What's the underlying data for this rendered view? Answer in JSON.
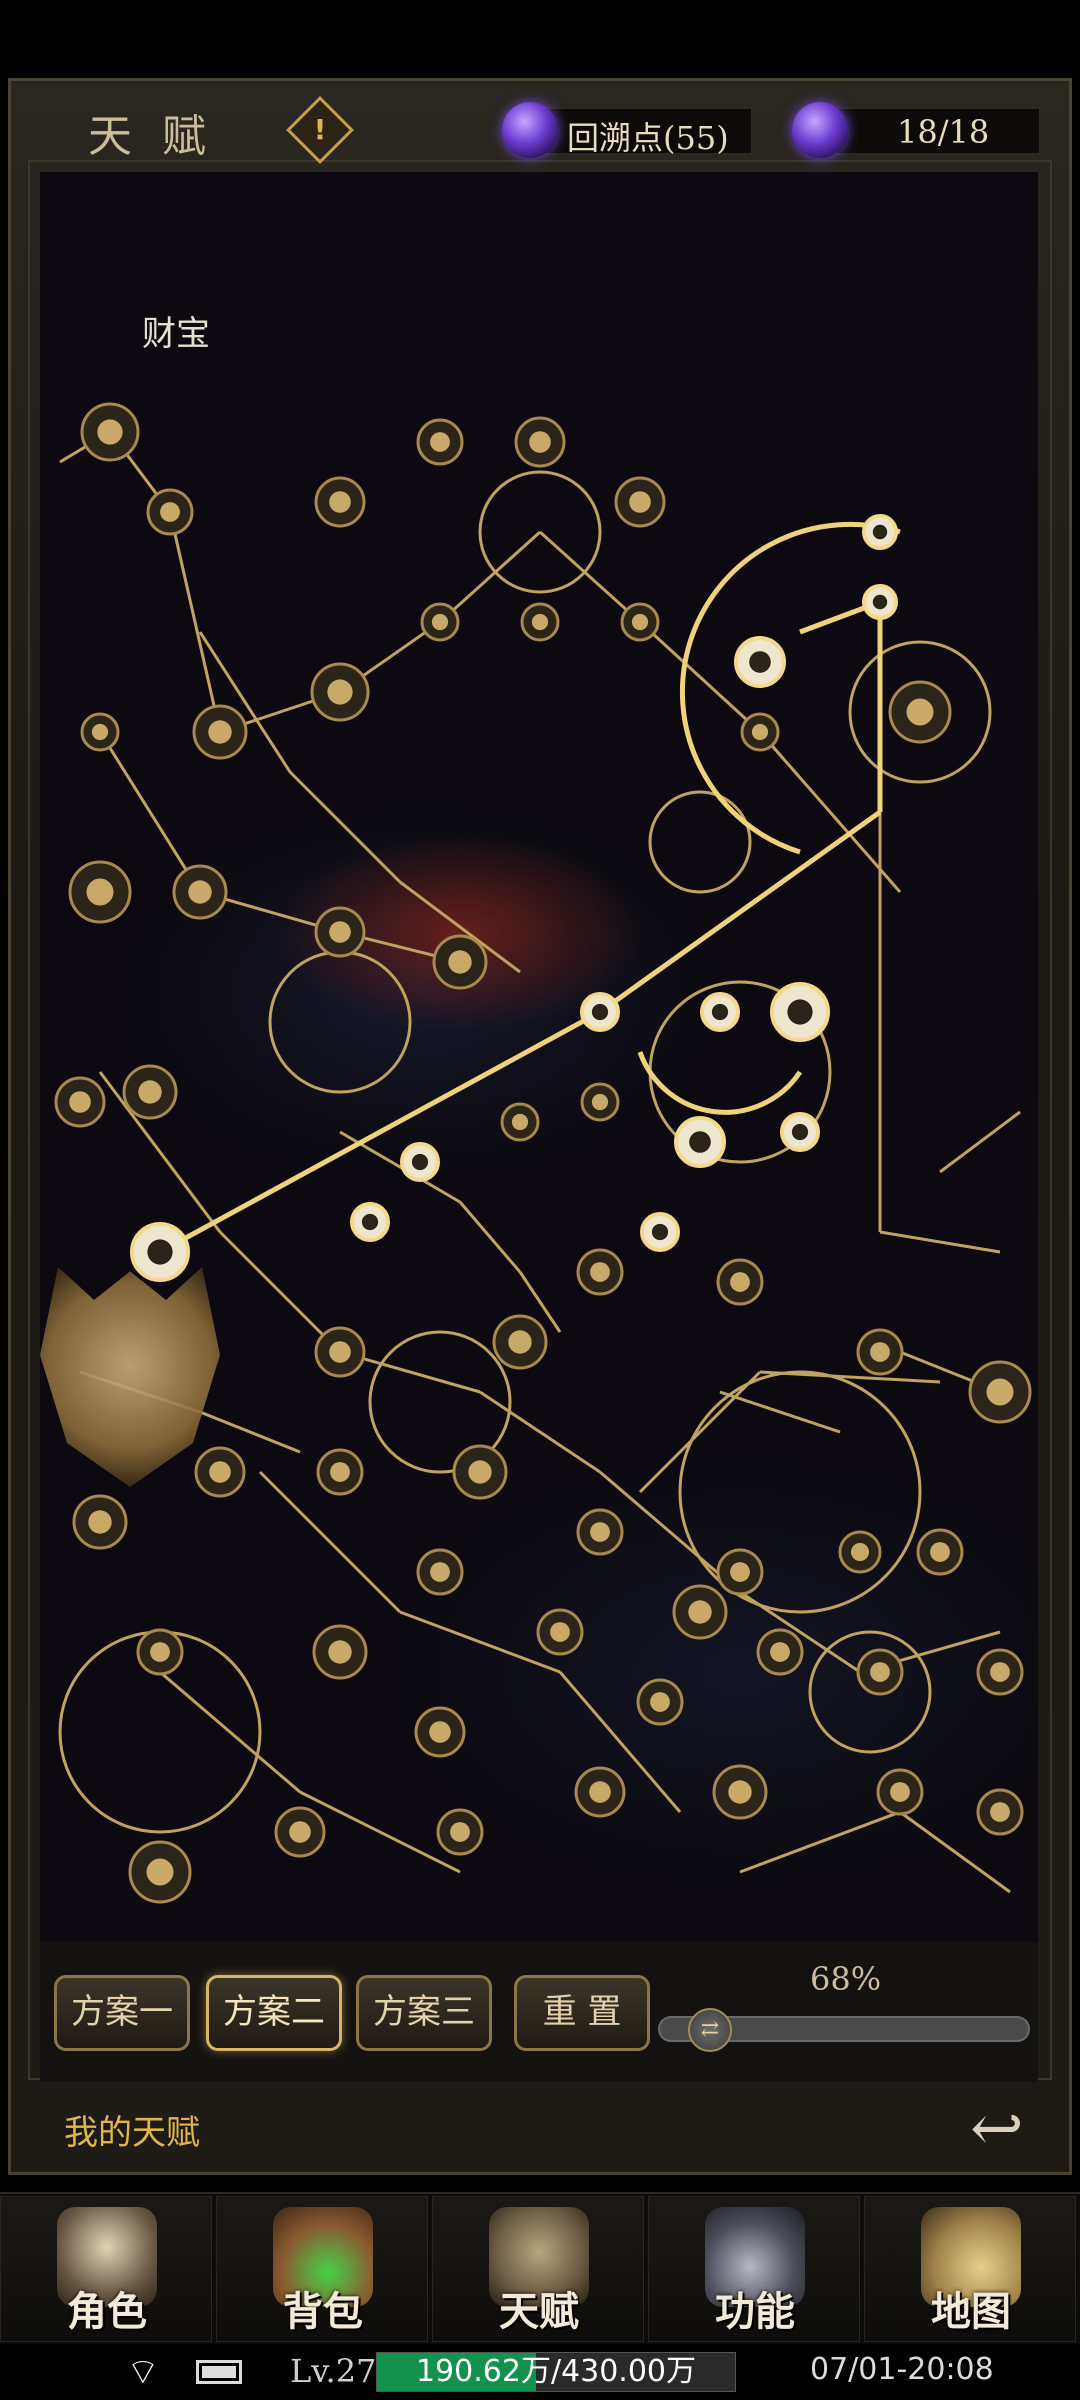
{
  "header": {
    "title": "天 赋",
    "warning_symbol": "!",
    "rewind_points_label": "回溯点(55)",
    "energy_label": "18/18"
  },
  "tree": {
    "node_label": "财宝",
    "link_color": "#bfa35e",
    "active_link_color": "#f0d27a"
  },
  "plans": {
    "items": [
      "方案一",
      "方案二",
      "方案三"
    ],
    "active_index": 1,
    "reset_label": "重 置",
    "progress_text": "68%",
    "progress_value": 0.68
  },
  "footer": {
    "my_talent_label": "我的天赋",
    "back_icon": "back-arrow-icon"
  },
  "nav": {
    "items": [
      "角色",
      "背包",
      "天赋",
      "功能",
      "地图"
    ],
    "icons": [
      "hooded-character-icon",
      "bag-potion-icon",
      "dragon-crest-icon",
      "anvil-icon",
      "map-compass-icon"
    ]
  },
  "status": {
    "level": "Lv.27",
    "exp_text": "190.62万/430.00万",
    "exp_fraction": 0.443,
    "datetime": "07/01-20:08"
  },
  "colors": {
    "accent_gold": "#d6b565",
    "exp_green": "#13924e",
    "gem_purple": "#6a3bd0"
  }
}
